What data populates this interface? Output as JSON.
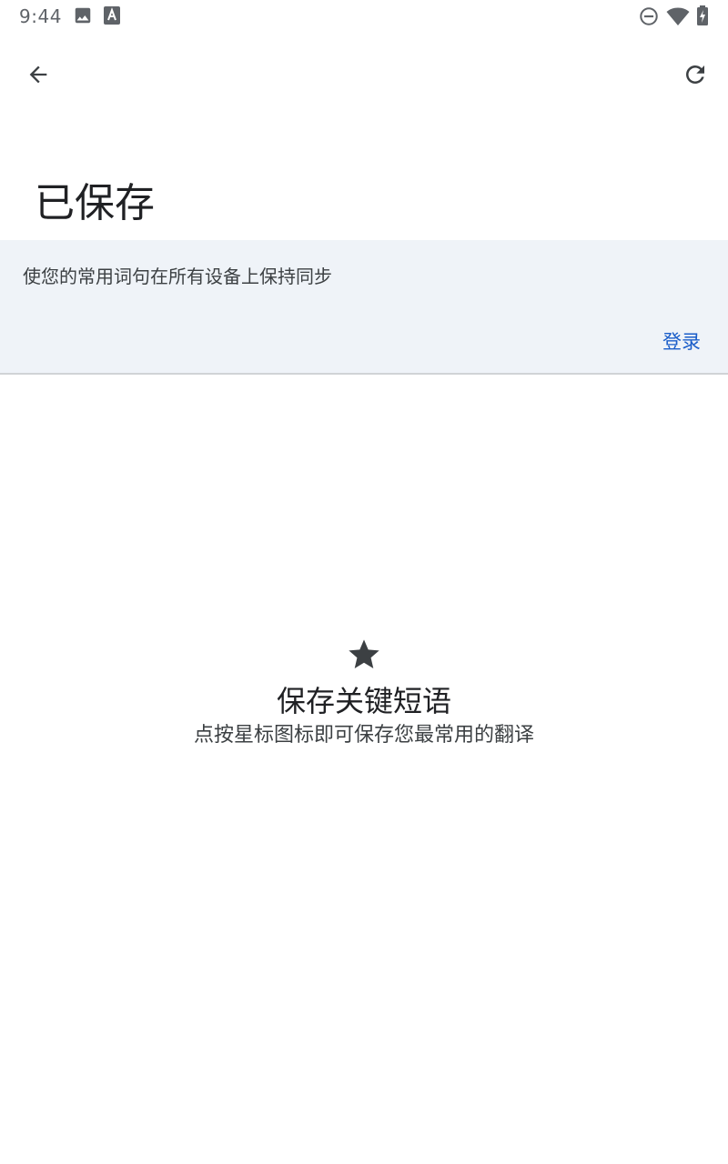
{
  "status_bar": {
    "time": "9:44",
    "left_icons": [
      "image-icon",
      "translate-icon"
    ],
    "right_icons": [
      "do-not-disturb-icon",
      "wifi-icon",
      "battery-charging-icon"
    ]
  },
  "toolbar": {
    "back_icon": "arrow-back-icon",
    "refresh_icon": "refresh-icon"
  },
  "page": {
    "title": "已保存"
  },
  "sync_card": {
    "message": "使您的常用词句在所有设备上保持同步",
    "login_label": "登录"
  },
  "empty_state": {
    "icon": "star-icon",
    "title": "保存关键短语",
    "description": "点按星标图标即可保存您最常用的翻译"
  },
  "colors": {
    "accent": "#1a5dc9",
    "card_background": "#eff3f8",
    "icon_gray": "#5f6368",
    "text_primary": "#202124"
  }
}
